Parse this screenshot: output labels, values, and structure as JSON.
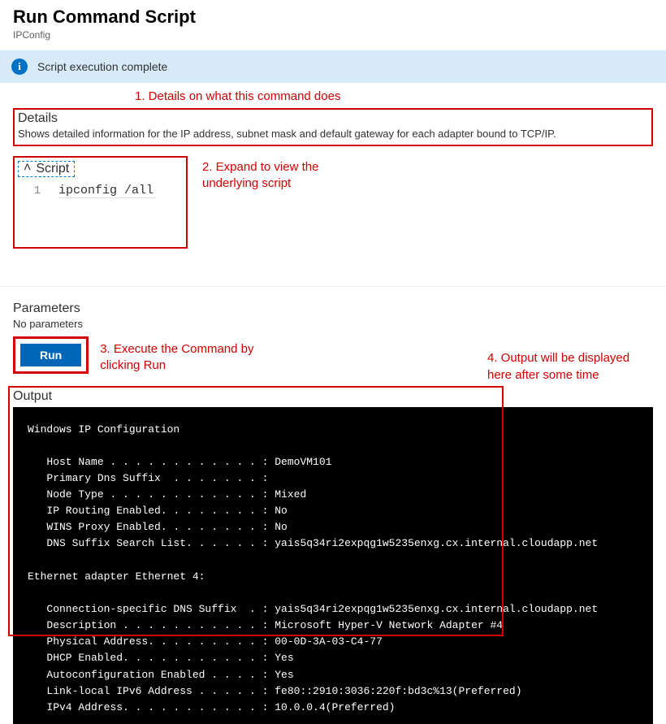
{
  "header": {
    "title": "Run Command Script",
    "subtitle": "IPConfig"
  },
  "status": {
    "icon_glyph": "i",
    "text": "Script execution complete"
  },
  "annotations": {
    "a1": "1. Details on what this command does",
    "a2": "2. Expand to view the underlying script",
    "a3": "3. Execute the Command by clicking Run",
    "a4": "4. Output will be displayed here after some time"
  },
  "details": {
    "heading": "Details",
    "text": "Shows detailed information for the IP address, subnet mask and default gateway for each adapter bound to TCP/IP."
  },
  "script": {
    "heading": "Script",
    "chevron": "˄",
    "line_number": "1",
    "code": "ipconfig /all"
  },
  "parameters": {
    "heading": "Parameters",
    "text": "No parameters"
  },
  "run": {
    "label": "Run"
  },
  "output": {
    "heading": "Output",
    "text": "Windows IP Configuration\n\n   Host Name . . . . . . . . . . . . : DemoVM101\n   Primary Dns Suffix  . . . . . . . :\n   Node Type . . . . . . . . . . . . : Mixed\n   IP Routing Enabled. . . . . . . . : No\n   WINS Proxy Enabled. . . . . . . . : No\n   DNS Suffix Search List. . . . . . : yais5q34ri2expqg1w5235enxg.cx.internal.cloudapp.net\n\nEthernet adapter Ethernet 4:\n\n   Connection-specific DNS Suffix  . : yais5q34ri2expqg1w5235enxg.cx.internal.cloudapp.net\n   Description . . . . . . . . . . . : Microsoft Hyper-V Network Adapter #4\n   Physical Address. . . . . . . . . : 00-0D-3A-03-C4-77\n   DHCP Enabled. . . . . . . . . . . : Yes\n   Autoconfiguration Enabled . . . . : Yes\n   Link-local IPv6 Address . . . . . : fe80::2910:3036:220f:bd3c%13(Preferred)\n   IPv4 Address. . . . . . . . . . . : 10.0.0.4(Preferred)"
  }
}
